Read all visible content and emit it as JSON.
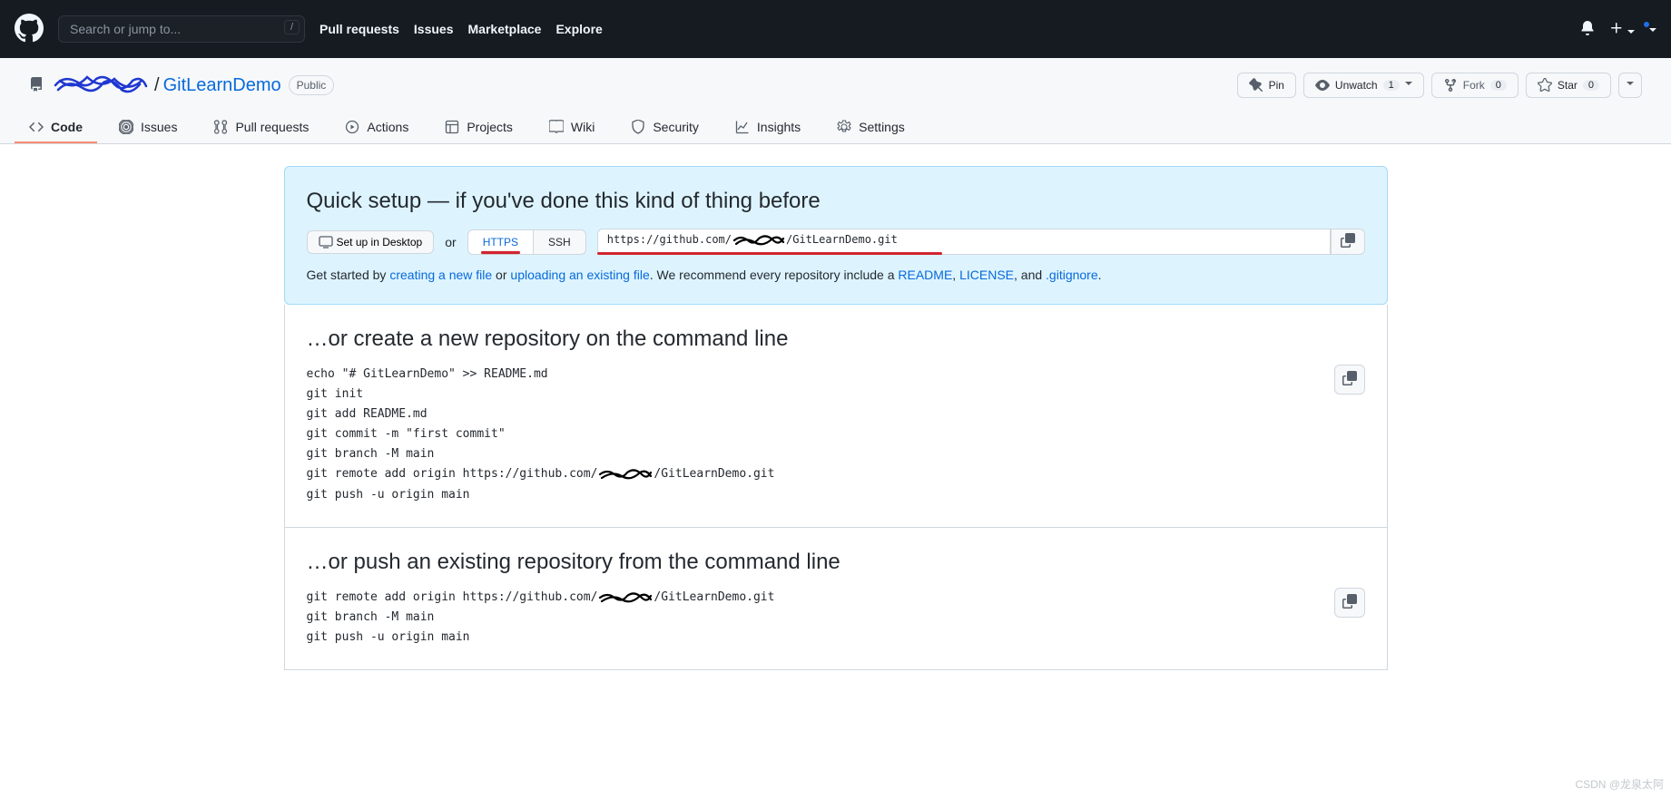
{
  "header": {
    "search_placeholder": "Search or jump to...",
    "nav": [
      "Pull requests",
      "Issues",
      "Marketplace",
      "Explore"
    ]
  },
  "repo": {
    "owner_redacted": "████████",
    "separator": "/",
    "name": "GitLearnDemo",
    "visibility": "Public",
    "actions": {
      "pin_label": "Pin",
      "unwatch_label": "Unwatch",
      "unwatch_count": "1",
      "fork_label": "Fork",
      "fork_count": "0",
      "star_label": "Star",
      "star_count": "0"
    },
    "tabs": [
      "Code",
      "Issues",
      "Pull requests",
      "Actions",
      "Projects",
      "Wiki",
      "Security",
      "Insights",
      "Settings"
    ]
  },
  "quick_setup": {
    "title": "Quick setup — if you've done this kind of thing before",
    "desktop_btn": "Set up in Desktop",
    "or": "or",
    "https": "HTTPS",
    "ssh": "SSH",
    "url_pre": "https://github.com/",
    "url_owner_redacted": "████████",
    "url_post": "/GitLearnDemo.git",
    "getstarted_prefix": "Get started by ",
    "create_new_file": "creating a new file",
    "or2": " or ",
    "upload_existing": "uploading an existing file",
    "recommend": ". We recommend every repository include a ",
    "readme": "README",
    "comma": ", ",
    "license": "LICENSE",
    "and": ", and ",
    "gitignore": ".gitignore",
    "period": "."
  },
  "sections": {
    "create_title": "…or create a new repository on the command line",
    "create_code_l1": "echo \"# GitLearnDemo\" >> README.md",
    "create_code_l2": "git init",
    "create_code_l3": "git add README.md",
    "create_code_l4": "git commit -m \"first commit\"",
    "create_code_l5": "git branch -M main",
    "create_code_l6a": "git remote add origin https://github.com/",
    "create_code_l6b": "████████",
    "create_code_l6c": "/GitLearnDemo.git",
    "create_code_l7": "git push -u origin main",
    "push_title": "…or push an existing repository from the command line",
    "push_code_l1a": "git remote add origin https://github.com/",
    "push_code_l1b": "████████",
    "push_code_l1c": "/GitLearnDemo.git",
    "push_code_l2": "git branch -M main",
    "push_code_l3": "git push -u origin main"
  },
  "watermark": "CSDN @龙泉太阿"
}
